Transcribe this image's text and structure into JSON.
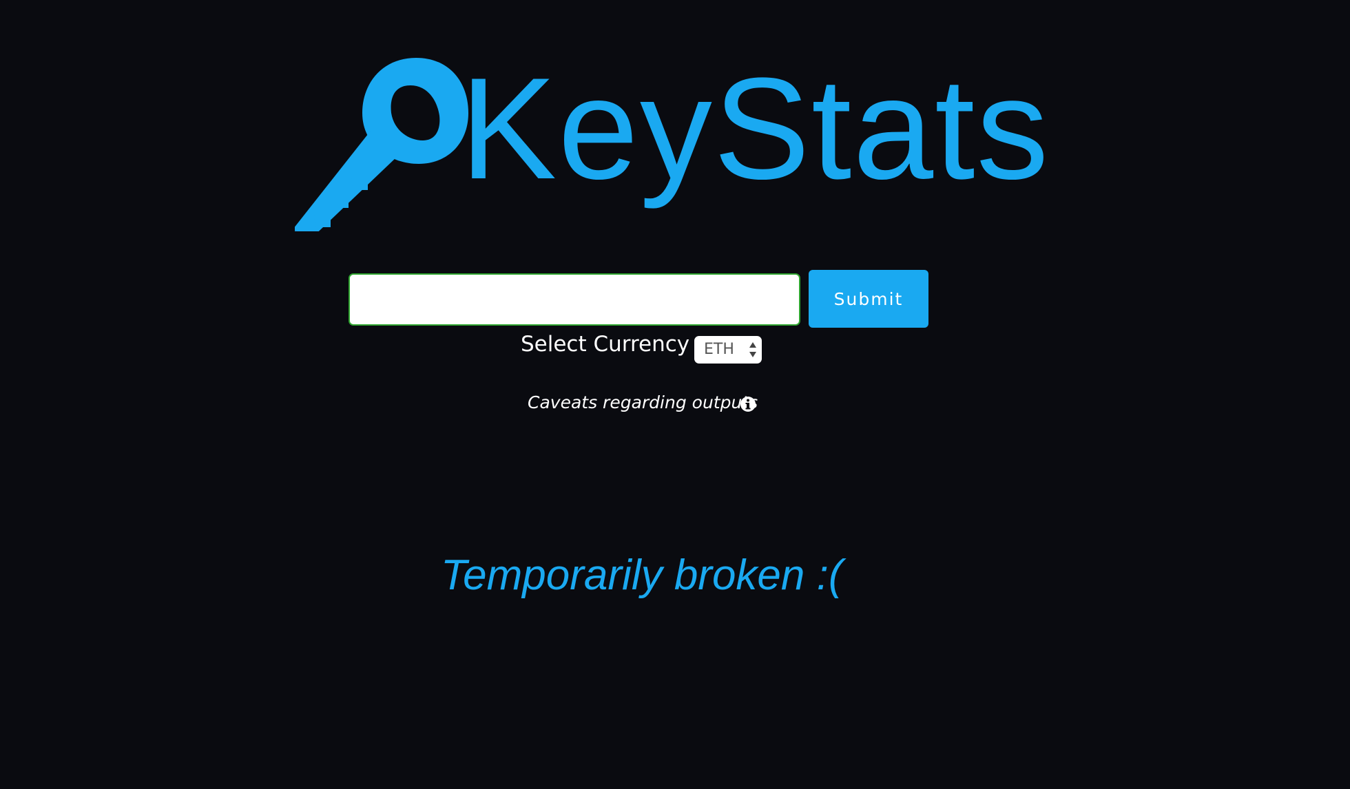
{
  "logo": {
    "icon": "key-icon",
    "text": "KeyStats"
  },
  "search": {
    "value": "",
    "placeholder": "",
    "submit_label": "Submit"
  },
  "currency": {
    "label": "Select Currency",
    "selected": "ETH"
  },
  "caveats": {
    "text": "Caveats regarding outputs",
    "icon": "info-icon"
  },
  "status": {
    "message": "Temporarily broken :("
  },
  "colors": {
    "background": "#0a0b10",
    "accent": "#1aa9f1",
    "input_border": "#2fa52f"
  }
}
